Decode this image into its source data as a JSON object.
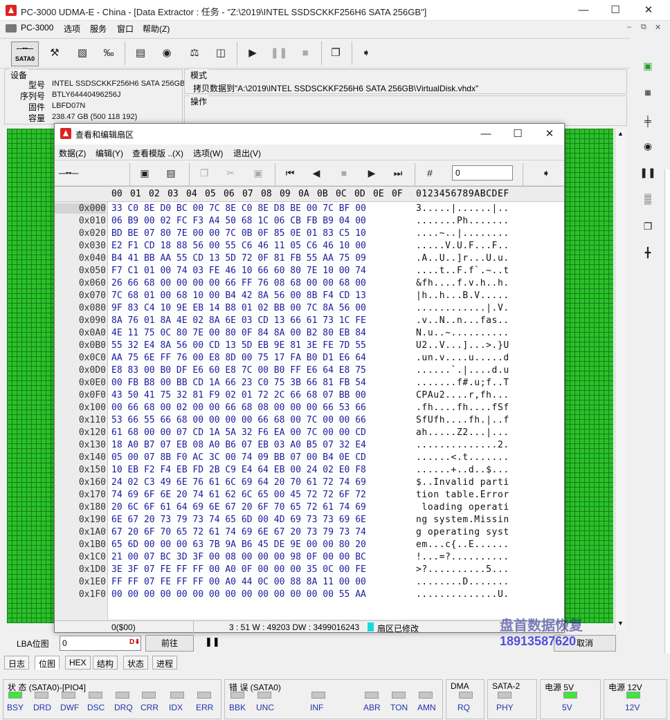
{
  "window": {
    "title": "PC-3000 UDMA-E - China - [Data Extractor : 任务 - \"Z:\\2019\\INTEL SSDSCKKF256H6 SATA 256GB\"]"
  },
  "menu": [
    "PC-3000",
    "选项",
    "服务",
    "窗口",
    "帮助(Z)"
  ],
  "toolbar": {
    "sata_label": "SATA0"
  },
  "device": {
    "title": "设备",
    "fields": [
      {
        "label": "型号",
        "value": "INTEL SSDSCKKF256H6 SATA 256GB"
      },
      {
        "label": "序列号",
        "value": "BTLY64440496256J"
      },
      {
        "label": "固件",
        "value": "LBFD07N"
      },
      {
        "label": "容量",
        "value": "238.47 GB (500 118 192)"
      }
    ]
  },
  "mode": {
    "title": "模式",
    "text": "拷贝数据到\"A:\\2019\\INTEL SSDSCKKF256H6 SATA 256GB\\VirtualDisk.vhdx\""
  },
  "operation": {
    "title": "操作"
  },
  "dialog": {
    "title": "查看和编辑扇区",
    "menu": [
      "数据(Z)",
      "编辑(Y)",
      "查看模版 ..(X)",
      "选项(W)",
      "退出(V)"
    ],
    "lba_value": "0",
    "hex_header": [
      "00",
      "01",
      "02",
      "03",
      "04",
      "05",
      "06",
      "07",
      "08",
      "09",
      "0A",
      "0B",
      "0C",
      "0D",
      "0E",
      "0F"
    ],
    "ascii_header": "0123456789ABCDEF",
    "rows": [
      {
        "offset": "0x000",
        "hex": "33 C0 8E D0 BC 00 7C 8E C0 8E D8 BE 00 7C BF 00",
        "ascii": "3.....|......|.."
      },
      {
        "offset": "0x010",
        "hex": "06 B9 00 02 FC F3 A4 50 68 1C 06 CB FB B9 04 00",
        "ascii": ".......Ph......."
      },
      {
        "offset": "0x020",
        "hex": "BD BE 07 80 7E 00 00 7C 0B 0F 85 0E 01 83 C5 10",
        "ascii": "....~..|........"
      },
      {
        "offset": "0x030",
        "hex": "E2 F1 CD 18 88 56 00 55 C6 46 11 05 C6 46 10 00",
        "ascii": ".....V.U.F...F.."
      },
      {
        "offset": "0x040",
        "hex": "B4 41 BB AA 55 CD 13 5D 72 0F 81 FB 55 AA 75 09",
        "ascii": ".A..U..]r...U.u."
      },
      {
        "offset": "0x050",
        "hex": "F7 C1 01 00 74 03 FE 46 10 66 60 80 7E 10 00 74",
        "ascii": "....t..F.f`.~..t"
      },
      {
        "offset": "0x060",
        "hex": "26 66 68 00 00 00 00 66 FF 76 08 68 00 00 68 00",
        "ascii": "&fh....f.v.h..h."
      },
      {
        "offset": "0x070",
        "hex": "7C 68 01 00 68 10 00 B4 42 8A 56 00 8B F4 CD 13",
        "ascii": "|h..h...B.V....."
      },
      {
        "offset": "0x080",
        "hex": "9F 83 C4 10 9E EB 14 B8 01 02 BB 00 7C 8A 56 00",
        "ascii": "............|.V."
      },
      {
        "offset": "0x090",
        "hex": "8A 76 01 8A 4E 02 8A 6E 03 CD 13 66 61 73 1C FE",
        "ascii": ".v..N..n...fas.."
      },
      {
        "offset": "0x0A0",
        "hex": "4E 11 75 0C 80 7E 00 80 0F 84 8A 00 B2 80 EB 84",
        "ascii": "N.u..~.........."
      },
      {
        "offset": "0x0B0",
        "hex": "55 32 E4 8A 56 00 CD 13 5D EB 9E 81 3E FE 7D 55",
        "ascii": "U2..V...]...>.}U"
      },
      {
        "offset": "0x0C0",
        "hex": "AA 75 6E FF 76 00 E8 8D 00 75 17 FA B0 D1 E6 64",
        "ascii": ".un.v....u.....d"
      },
      {
        "offset": "0x0D0",
        "hex": "E8 83 00 B0 DF E6 60 E8 7C 00 B0 FF E6 64 E8 75",
        "ascii": "......`.|....d.u"
      },
      {
        "offset": "0x0E0",
        "hex": "00 FB B8 00 BB CD 1A 66 23 C0 75 3B 66 81 FB 54",
        "ascii": ".......f#.u;f..T"
      },
      {
        "offset": "0x0F0",
        "hex": "43 50 41 75 32 81 F9 02 01 72 2C 66 68 07 BB 00",
        "ascii": "CPAu2....r,fh..."
      },
      {
        "offset": "0x100",
        "hex": "00 66 68 00 02 00 00 66 68 08 00 00 00 66 53 66",
        "ascii": ".fh....fh....fSf"
      },
      {
        "offset": "0x110",
        "hex": "53 66 55 66 68 00 00 00 00 66 68 00 7C 00 00 66",
        "ascii": "SfUfh....fh.|..f"
      },
      {
        "offset": "0x120",
        "hex": "61 68 00 00 07 CD 1A 5A 32 F6 EA 00 7C 00 00 CD",
        "ascii": "ah.....Z2...|..."
      },
      {
        "offset": "0x130",
        "hex": "18 A0 B7 07 EB 08 A0 B6 07 EB 03 A0 B5 07 32 E4",
        "ascii": "..............2."
      },
      {
        "offset": "0x140",
        "hex": "05 00 07 8B F0 AC 3C 00 74 09 BB 07 00 B4 0E CD",
        "ascii": "......<.t......."
      },
      {
        "offset": "0x150",
        "hex": "10 EB F2 F4 EB FD 2B C9 E4 64 EB 00 24 02 E0 F8",
        "ascii": "......+..d..$..."
      },
      {
        "offset": "0x160",
        "hex": "24 02 C3 49 6E 76 61 6C 69 64 20 70 61 72 74 69",
        "ascii": "$..Invalid parti"
      },
      {
        "offset": "0x170",
        "hex": "74 69 6F 6E 20 74 61 62 6C 65 00 45 72 72 6F 72",
        "ascii": "tion table.Error"
      },
      {
        "offset": "0x180",
        "hex": "20 6C 6F 61 64 69 6E 67 20 6F 70 65 72 61 74 69",
        "ascii": " loading operati"
      },
      {
        "offset": "0x190",
        "hex": "6E 67 20 73 79 73 74 65 6D 00 4D 69 73 73 69 6E",
        "ascii": "ng system.Missin"
      },
      {
        "offset": "0x1A0",
        "hex": "67 20 6F 70 65 72 61 74 69 6E 67 20 73 79 73 74",
        "ascii": "g operating syst"
      },
      {
        "offset": "0x1B0",
        "hex": "65 6D 00 00 00 63 7B 9A B6 45 DE 9E 00 00 80 20",
        "ascii": "em...c{..E......"
      },
      {
        "offset": "0x1C0",
        "hex": "21 00 07 BC 3D 3F 00 08 00 00 00 98 0F 00 00 BC",
        "ascii": "!...=?.........."
      },
      {
        "offset": "0x1D0",
        "hex": "3E 3F 07 FE FF FF 00 A0 0F 00 00 00 35 0C 00 FE",
        "ascii": ">?..........5..."
      },
      {
        "offset": "0x1E0",
        "hex": "FF FF 07 FE FF FF 00 A0 44 0C 00 88 8A 11 00 00",
        "ascii": "........D......."
      },
      {
        "offset": "0x1F0",
        "hex": "00 00 00 00 00 00 00 00 00 00 00 00 00 00 55 AA",
        "ascii": "..............U."
      }
    ],
    "status": {
      "position": "0($00)",
      "cursor": "3 : 51 W : 49203 DW : 3499016243",
      "modified": "扇区已修改"
    }
  },
  "lba": {
    "label": "LBA位图",
    "value": "0",
    "go_label": "前往",
    "cancel_label": "取消"
  },
  "tabs": [
    "日志",
    "位图",
    "HEX",
    "结构",
    "状态",
    "进程"
  ],
  "status_groups": [
    {
      "title": "状 态 (SATA0)-[PIO4]"
    },
    {
      "title": "错 误 (SATA0)"
    },
    {
      "title": "DMA"
    },
    {
      "title": "SATA-2"
    },
    {
      "title": "电源 5V"
    },
    {
      "title": "电源 12V"
    }
  ],
  "leds": [
    {
      "label": "BSY",
      "on": true
    },
    {
      "label": "DRD",
      "on": false
    },
    {
      "label": "DWF",
      "on": false
    },
    {
      "label": "DSC",
      "on": false
    },
    {
      "label": "DRQ",
      "on": false
    },
    {
      "label": "CRR",
      "on": false
    },
    {
      "label": "IDX",
      "on": false
    },
    {
      "label": "ERR",
      "on": false
    },
    {
      "label": "BBK",
      "on": false
    },
    {
      "label": "UNC",
      "on": false
    },
    {
      "label": "INF",
      "on": false
    },
    {
      "label": "ABR",
      "on": false
    },
    {
      "label": "TON",
      "on": false
    },
    {
      "label": "AMN",
      "on": false
    },
    {
      "label": "RQ",
      "on": false
    },
    {
      "label": "PHY",
      "on": false
    },
    {
      "label": "5V",
      "on": true
    },
    {
      "label": "12V",
      "on": true
    }
  ],
  "watermark": {
    "brand": "盘首数据恢复",
    "phone": "18913587620"
  },
  "colors": {
    "hex_text": "#1a1aa0",
    "grid_green": "#27c227",
    "led_on": "#3ee63e",
    "modified": "#18d8e0"
  }
}
